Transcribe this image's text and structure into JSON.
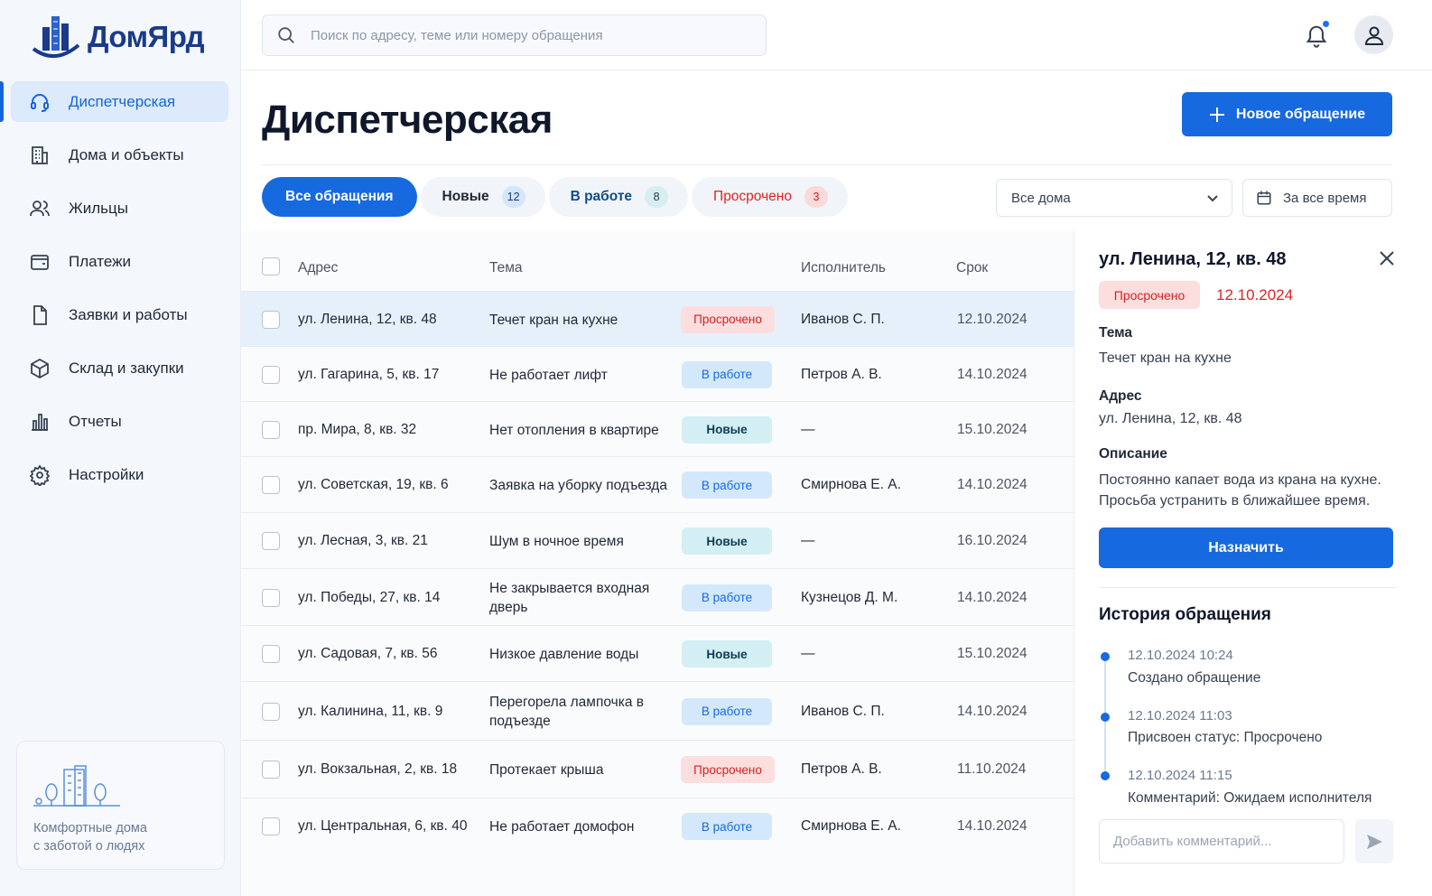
{
  "app": {
    "logo_text": "ДомЯрд",
    "accent": "#1769e0"
  },
  "sidebar": {
    "items": [
      {
        "label": "Диспетчерская",
        "icon": "headset-icon",
        "active": true
      },
      {
        "label": "Дома и объекты",
        "icon": "building-icon"
      },
      {
        "label": "Жильцы",
        "icon": "users-icon"
      },
      {
        "label": "Платежи",
        "icon": "wallet-icon"
      },
      {
        "label": "Заявки и работы",
        "icon": "document-icon"
      },
      {
        "label": "Склад и закупки",
        "icon": "box-icon"
      },
      {
        "label": "Отчеты",
        "icon": "bar-chart-icon"
      },
      {
        "label": "Настройки",
        "icon": "gear-icon"
      }
    ],
    "promo_line1": "Комфортные дома",
    "promo_line2": "с заботой о людях"
  },
  "header": {
    "search_placeholder": "Поиск по адресу, теме или номеру обращения"
  },
  "page": {
    "title": "Диспетчерская",
    "new_button": "Новое обращение"
  },
  "tabs": [
    {
      "label": "Все обращения",
      "active": true
    },
    {
      "label": "Новые",
      "count": "12"
    },
    {
      "label": "В работе",
      "count": "8"
    },
    {
      "label": "Просрочено",
      "count": "3"
    }
  ],
  "filters": {
    "houses": "Все дома",
    "period": "За все время"
  },
  "table": {
    "columns": [
      "Адрес",
      "Тема",
      "Исполнитель",
      "Срок"
    ],
    "rows": [
      {
        "address": "ул. Ленина, 12, кв. 48",
        "topic": "Течет кран на кухне",
        "status": "Просрочено",
        "status_type": "red",
        "assignee": "Иванов С. П.",
        "due": "12.10.2024"
      },
      {
        "address": "ул. Гагарина, 5, кв. 17",
        "topic": "Не работает лифт",
        "status": "В работе",
        "status_type": "blue",
        "assignee": "Петров А. В.",
        "due": "14.10.2024"
      },
      {
        "address": "пр. Мира, 8, кв. 32",
        "topic": "Нет отопления в квартире",
        "status": "Новые",
        "status_type": "teal",
        "assignee": "—",
        "due": "15.10.2024"
      },
      {
        "address": "ул. Советская, 19, кв. 6",
        "topic": "Заявка на уборку подъезда",
        "status": "В работе",
        "status_type": "blue",
        "assignee": "Смирнова Е. А.",
        "due": "14.10.2024"
      },
      {
        "address": "ул. Лесная, 3, кв. 21",
        "topic": "Шум в ночное время",
        "status": "Новые",
        "status_type": "teal",
        "assignee": "—",
        "due": "16.10.2024"
      },
      {
        "address": "ул. Победы, 27, кв. 14",
        "topic": "Не закрывается входная дверь",
        "status": "В работе",
        "status_type": "blue",
        "assignee": "Кузнецов Д. М.",
        "due": "14.10.2024"
      },
      {
        "address": "ул. Садовая, 7, кв. 56",
        "topic": "Низкое давление воды",
        "status": "Новые",
        "status_type": "teal",
        "assignee": "—",
        "due": "15.10.2024"
      },
      {
        "address": "ул. Калинина, 11, кв. 9",
        "topic": "Перегорела лампочка в подъезде",
        "status": "В работе",
        "status_type": "blue",
        "assignee": "Иванов С. П.",
        "due": "14.10.2024"
      },
      {
        "address": "ул. Вокзальная, 2, кв. 18",
        "topic": "Протекает крыша",
        "status": "Просрочено",
        "status_type": "red",
        "assignee": "Петров А. В.",
        "due": "11.10.2024"
      },
      {
        "address": "ул. Центральная, 6, кв. 40",
        "topic": "Не работает домофон",
        "status": "В работе",
        "status_type": "blue",
        "assignee": "Смирнова Е. А.",
        "due": "14.10.2024"
      }
    ]
  },
  "detail": {
    "title": "ул. Ленина, 12, кв. 48",
    "status": "Просрочено",
    "date": "12.10.2024",
    "topic_label": "Тема",
    "topic": "Течет кран на кухне",
    "address_label": "Адрес",
    "address": "ул. Ленина, 12, кв. 48",
    "description_label": "Описание",
    "description": "Постоянно капает вода из крана на кухне. Просьба устранить в ближайшее время.",
    "assign_button": "Назначить",
    "history_title": "История обращения",
    "history": [
      {
        "time": "12.10.2024 10:24",
        "text": "Создано обращение"
      },
      {
        "time": "12.10.2024 11:03",
        "text": "Присвоен статус: Просрочено"
      },
      {
        "time": "12.10.2024 11:15",
        "text": "Комментарий: Ожидаем исполнителя"
      }
    ],
    "comment_placeholder": "Добавить комментарий..."
  }
}
